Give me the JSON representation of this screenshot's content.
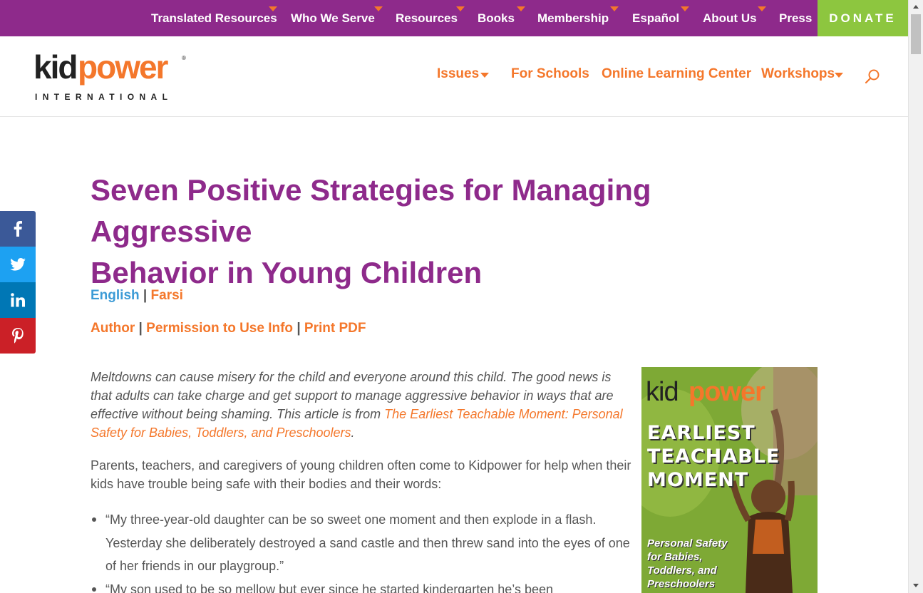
{
  "topnav": {
    "items": [
      {
        "label": "Translated Resources",
        "has_dropdown": true
      },
      {
        "label": "Who We Serve",
        "has_dropdown": true
      },
      {
        "label": "Resources",
        "has_dropdown": true
      },
      {
        "label": "Books",
        "has_dropdown": true
      },
      {
        "label": "Membership",
        "has_dropdown": true
      },
      {
        "label": "Español",
        "has_dropdown": true
      },
      {
        "label": "About Us",
        "has_dropdown": true
      },
      {
        "label": "Press",
        "has_dropdown": false
      }
    ],
    "donate_label": "DONATE"
  },
  "logo": {
    "word_left": "kid",
    "word_right": "power",
    "registered": "®",
    "tagline": "INTERNATIONAL"
  },
  "mainnav": {
    "items": [
      {
        "label": "Issues",
        "has_dropdown": true
      },
      {
        "label": "For Schools",
        "has_dropdown": false
      },
      {
        "label": "Online Learning Center",
        "has_dropdown": false
      },
      {
        "label": "Workshops",
        "has_dropdown": true
      }
    ],
    "search_icon": "search-icon"
  },
  "social": [
    {
      "name": "facebook",
      "glyph": "f",
      "color": "#3b5998"
    },
    {
      "name": "twitter",
      "glyph": "t",
      "color": "#1da1f2"
    },
    {
      "name": "linkedin",
      "glyph": "in",
      "color": "#0077b5"
    },
    {
      "name": "pinterest",
      "glyph": "p",
      "color": "#cb2027"
    }
  ],
  "article": {
    "title_line1": "Seven Positive Strategies for Managing Aggressive",
    "title_line2": "Behavior in Young Children",
    "lang_english": "English",
    "lang_sep": "|",
    "lang_farsi": "Farsi",
    "link_author": "Author",
    "link_sep1": "|",
    "link_permission": "Permission to Use Info",
    "link_sep2": "|",
    "link_pdf": "Print PDF",
    "intro_text": "Meltdowns can cause misery for the child and everyone around this child. The good news is that adults can take charge and get support to manage aggressive behavior in ways that are effective without being shaming. This article is from ",
    "intro_link": "The Earliest Teachable Moment: Personal Safety for Babies, Toddlers, and Preschoolers",
    "intro_end": ".",
    "para1": "Parents, teachers, and caregivers of young children often come to Kidpower for help when their kids have trouble being safe with their bodies and their words:",
    "bullet1": "“My three-year-old daughter can be so sweet one moment and then explode in a flash. Yesterday she deliberately destroyed a sand castle and then threw sand into the eyes of one of her friends in our playgroup.”",
    "bullet2": "“My son used to be so mellow but ever since he started kindergarten he’s been"
  },
  "book": {
    "brand_left": "kid",
    "brand_right": "power",
    "title_l1": "EARLIEST",
    "title_l2": "TEACHABLE",
    "title_l3": "MOMENT",
    "sub_l1": "Personal Safety",
    "sub_l2": "for Babies,",
    "sub_l3": "Toddlers, and",
    "sub_l4": "Preschoolers"
  },
  "colors": {
    "brand_purple": "#8e2a8b",
    "brand_orange": "#f4772b",
    "donate_green": "#8dc63f",
    "link_blue": "#3c9bd6"
  }
}
